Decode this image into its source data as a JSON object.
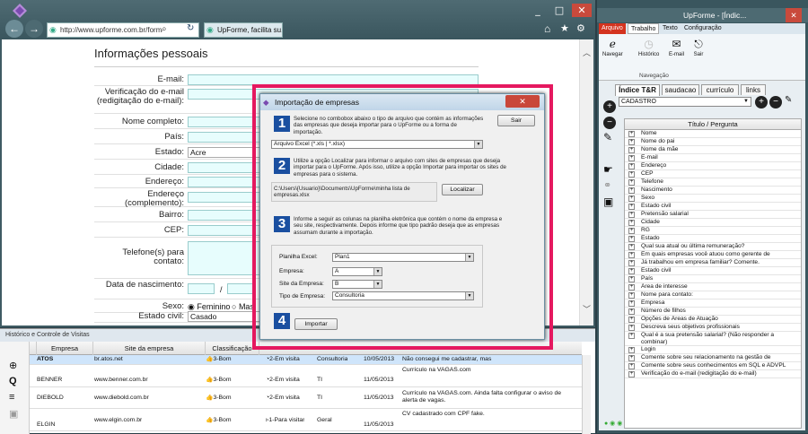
{
  "browser": {
    "window_controls": [
      "_",
      "□",
      "✕"
    ],
    "address": "http://www.upforme.com.br/form",
    "address_bold": "upforme.com.br",
    "tab_title": "UpForme, facilita su...",
    "page_title": "Informações pessoais",
    "fields": [
      {
        "label": "E-mail:",
        "value": ""
      },
      {
        "label": "Verificação do e-mail (redigitação do e-mail):",
        "value": ""
      },
      {
        "label": "Nome completo:",
        "value": ""
      },
      {
        "label": "País:",
        "value": ""
      },
      {
        "label": "Estado:",
        "value": "Acre"
      },
      {
        "label": "Cidade:",
        "value": ""
      },
      {
        "label": "Endereço:",
        "value": ""
      },
      {
        "label": "Endereço (complemento):",
        "value": ""
      },
      {
        "label": "Bairro:",
        "value": ""
      },
      {
        "label": "CEP:",
        "value": ""
      },
      {
        "label": "Telefone(s) para contato:",
        "value": ""
      },
      {
        "label": "Data de nascimento:",
        "value": "/"
      },
      {
        "label": "Sexo:",
        "value": ""
      },
      {
        "label": "Estado civil:",
        "value": "Casado"
      }
    ],
    "sexo_options": [
      "Feminino",
      "Mas"
    ],
    "date_sep": "/"
  },
  "dialog": {
    "title": "Importação de empresas",
    "close": "✕",
    "step1_text": "Selecione no combobox abaixo o tipo de arquivo que contém as informações das empresas que deseja importar para o UpForme ou a forma de importação.",
    "exit_label": "Sair",
    "file_type": "Arquivo Excel (*.xls | *.xlsx)",
    "step2_text": "Utilize a opção Localizar para informar o arquivo com sites de empresas que deseja importar para o UpForme. Após isso, utilize a opção Importar para importar os sites de empresas para o sistema.",
    "file_path": "C:\\Users\\{Usuario}\\Documents\\UpForme\\minha lista de empresas.xlsx",
    "locate_label": "Localizar",
    "step3_text": "Informe a seguir as colunas na planilha eletrônica que contém o nome da empresa e seu site, respectivamente. Depois informe que tipo padrão deseja que as empresas assumam durante a importação.",
    "sheet_label": "Planilha Excel:",
    "sheet_value": "Plan1",
    "company_label": "Empresa:",
    "company_value": "A",
    "site_label": "Site da Empresa:",
    "site_value": "B",
    "type_label": "Tipo de Empresa:",
    "type_value": "Consultoria",
    "import_label": "Importar",
    "steps": [
      "1",
      "2",
      "3",
      "4"
    ]
  },
  "history": {
    "title": "Histórico e Controle de Visitas",
    "columns": [
      "Empresa",
      "Site da empresa",
      "Classificação"
    ],
    "rows": [
      {
        "empresa": "ATOS",
        "site": "br.atos.net",
        "class": "3-Bom",
        "status": "2-Em visita",
        "tipo": "Consultoria",
        "data": "10/05/2013",
        "obs": "Não consegui me cadastrar, mas"
      },
      {
        "empresa": "BENNER",
        "site": "www.benner.com.br",
        "class": "3-Bom",
        "status": "2-Em visita",
        "tipo": "TI",
        "data": "11/05/2013",
        "obs": "Currículo na VAGAS.com"
      },
      {
        "empresa": "DIEBOLD",
        "site": "www.diebold.com.br",
        "class": "3-Bom",
        "status": "2-Em visita",
        "tipo": "TI",
        "data": "11/05/2013",
        "obs": "Currículo na VAGAS.com. Ainda falta configurar o aviso de alerta de vagas."
      },
      {
        "empresa": "ELGIN",
        "site": "www.elgin.com.br",
        "class": "3-Bom",
        "status": "1-Para visitar",
        "tipo": "Geral",
        "data": "11/05/2013",
        "obs": "CV cadastrado com CPF fake."
      }
    ]
  },
  "app": {
    "title": "UpForme - [Índic...",
    "ribbon_tabs": [
      "Arquivo",
      "Trabalho",
      "Texto",
      "Configuração"
    ],
    "ribbon_buttons": [
      "Navegar",
      "Histórico",
      "E-mail",
      "Sair"
    ],
    "ribbon_group": "Navegação",
    "index_tabs": [
      "Índice T&R",
      "saudacao",
      "currículo",
      "links"
    ],
    "category": "CADASTRO",
    "tree_header": "Título / Pergunta",
    "tree_items": [
      "Nome",
      "Nome do pai",
      "Nome da mãe",
      "E-mail",
      "Endereço",
      "CEP",
      "Telefone",
      "Nascimento",
      "Sexo",
      "Estado civil",
      "Pretensão salarial",
      "Cidade",
      "RG",
      "Estado",
      "Qual sua atual ou última remuneração?",
      "Em quais empresas você atuou como gerente de",
      "Já trabalhou em empresa familiar? Comente.",
      "Estado civil",
      "País",
      "Área de interesse",
      "Nome para contato:",
      "Empresa",
      "Número de filhos",
      "Opções de Áreas de Atuação",
      "Descreva seus objetivos profissionais",
      "Qual é a sua pretensão salarial? (Não responder a combinar)",
      "Login",
      "Comente sobre seu relacionamento na gestão de",
      "Comente sobre seus conhecimentos em SQL e ADVPL",
      "Verificação do e-mail (redigitação do e-mail)"
    ]
  },
  "colors": {
    "highlight": "#e5185f",
    "step_blue": "#1a4fa0",
    "field_bg": "#e7fdfd"
  }
}
